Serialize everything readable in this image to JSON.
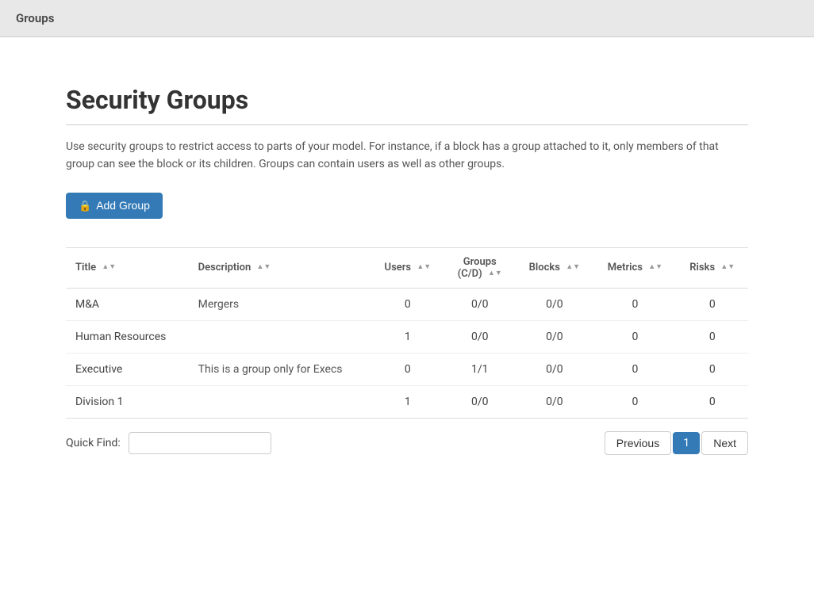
{
  "topbar": {
    "title": "Groups"
  },
  "page": {
    "title": "Security Groups",
    "description": "Use security groups to restrict access to parts of your model. For instance, if a block has a group attached to it, only members of that group can see the block or its children. Groups can contain users as well as other groups."
  },
  "buttons": {
    "add_group": "Add Group"
  },
  "table": {
    "columns": [
      {
        "label": "Title",
        "sortable": true
      },
      {
        "label": "Description",
        "sortable": true
      },
      {
        "label": "Users",
        "sortable": true
      },
      {
        "label": "Groups\n(C/D)",
        "sortable": true
      },
      {
        "label": "Blocks",
        "sortable": true
      },
      {
        "label": "Metrics",
        "sortable": true
      },
      {
        "label": "Risks",
        "sortable": true
      }
    ],
    "rows": [
      {
        "title": "M&A",
        "description": "Mergers",
        "users": "0",
        "groups": "0/0",
        "blocks": "0/0",
        "metrics": "0",
        "risks": "0"
      },
      {
        "title": "Human Resources",
        "description": "",
        "users": "1",
        "groups": "0/0",
        "blocks": "0/0",
        "metrics": "0",
        "risks": "0"
      },
      {
        "title": "Executive",
        "description": "This is a group only for Execs",
        "users": "0",
        "groups": "1/1",
        "blocks": "0/0",
        "metrics": "0",
        "risks": "0"
      },
      {
        "title": "Division 1",
        "description": "",
        "users": "1",
        "groups": "0/0",
        "blocks": "0/0",
        "metrics": "0",
        "risks": "0"
      }
    ]
  },
  "footer": {
    "quick_find_label": "Quick Find:",
    "quick_find_placeholder": "",
    "pagination": {
      "previous_label": "Previous",
      "next_label": "Next",
      "current_page": "1"
    }
  }
}
